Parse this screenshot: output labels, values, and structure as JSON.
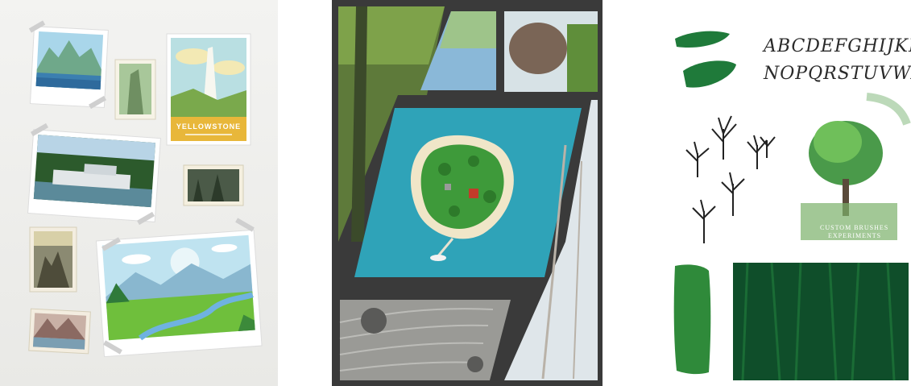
{
  "panels": {
    "wall": {
      "poster_title": "YELLOWSTONE",
      "colors": {
        "wall": "#eeeeec",
        "poster_sky": "#b9dfe2",
        "poster_banner": "#e8b73a"
      }
    },
    "collage": {
      "colors": {
        "frame": "#3a3a3a",
        "water": "#2fa3b8",
        "sand": "#f0e6c8",
        "island": "#3e9a3a"
      }
    },
    "brushes": {
      "alphabet_line1": "ABCDEFGHIJKLM",
      "alphabet_line2": "NOPQRSTUVWXYZ",
      "caption_line1": "CUSTOM BRUSHES",
      "caption_line2": "EXPERIMENTS",
      "colors": {
        "brush_green": "#1f7a3a",
        "dark_green": "#0f4e2a"
      }
    }
  }
}
